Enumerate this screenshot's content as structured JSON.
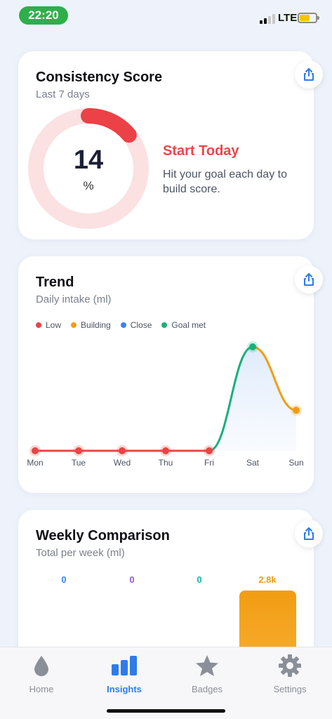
{
  "status_bar": {
    "time": "22:20",
    "network": "LTE",
    "battery_color": "#f5c400"
  },
  "consistency": {
    "title": "Consistency Score",
    "subtitle": "Last 7 days",
    "score": "14",
    "unit": "%",
    "score_value": 14,
    "headline": "Start Today",
    "description": "Hit your goal each day to build score.",
    "share_icon": "share-icon"
  },
  "trend": {
    "title": "Trend",
    "subtitle": "Daily intake (ml)",
    "legend": [
      {
        "label": "Low",
        "color": "#e84545"
      },
      {
        "label": "Building",
        "color": "#f29d12"
      },
      {
        "label": "Close",
        "color": "#3b82f6"
      },
      {
        "label": "Goal met",
        "color": "#19b07a"
      }
    ],
    "share_icon": "share-icon"
  },
  "chart_data": {
    "type": "line",
    "title": "Trend",
    "categories": [
      "Mon",
      "Tue",
      "Wed",
      "Thu",
      "Fri",
      "Sat",
      "Sun"
    ],
    "series": [
      {
        "values": [
          0,
          0,
          0,
          0,
          0,
          1.0,
          0.39
        ],
        "point_status": [
          "Low",
          "Low",
          "Low",
          "Low",
          "Low",
          "Goal met",
          "Building"
        ]
      }
    ],
    "grid": false,
    "legend_position": "top-left"
  },
  "weekly": {
    "title": "Weekly Comparison",
    "subtitle": "Total per week (ml)",
    "bars": [
      {
        "value_label": "0",
        "value": 0,
        "color": "#3b82f6"
      },
      {
        "value_label": "0",
        "value": 0,
        "color": "#8b5cf6"
      },
      {
        "value_label": "0",
        "value": 0,
        "color": "#14b8a6"
      },
      {
        "value_label": "2.8k",
        "value": 2800,
        "color": "#f29d12"
      }
    ],
    "share_icon": "share-icon"
  },
  "tabs": [
    {
      "label": "Home",
      "icon": "droplet-icon",
      "active": false
    },
    {
      "label": "Insights",
      "icon": "bar-chart-icon",
      "active": true
    },
    {
      "label": "Badges",
      "icon": "star-icon",
      "active": false
    },
    {
      "label": "Settings",
      "icon": "gear-icon",
      "active": false
    }
  ],
  "colors": {
    "accent": "#2f7be8",
    "danger": "#e8474a",
    "background": "#eef3fb"
  }
}
